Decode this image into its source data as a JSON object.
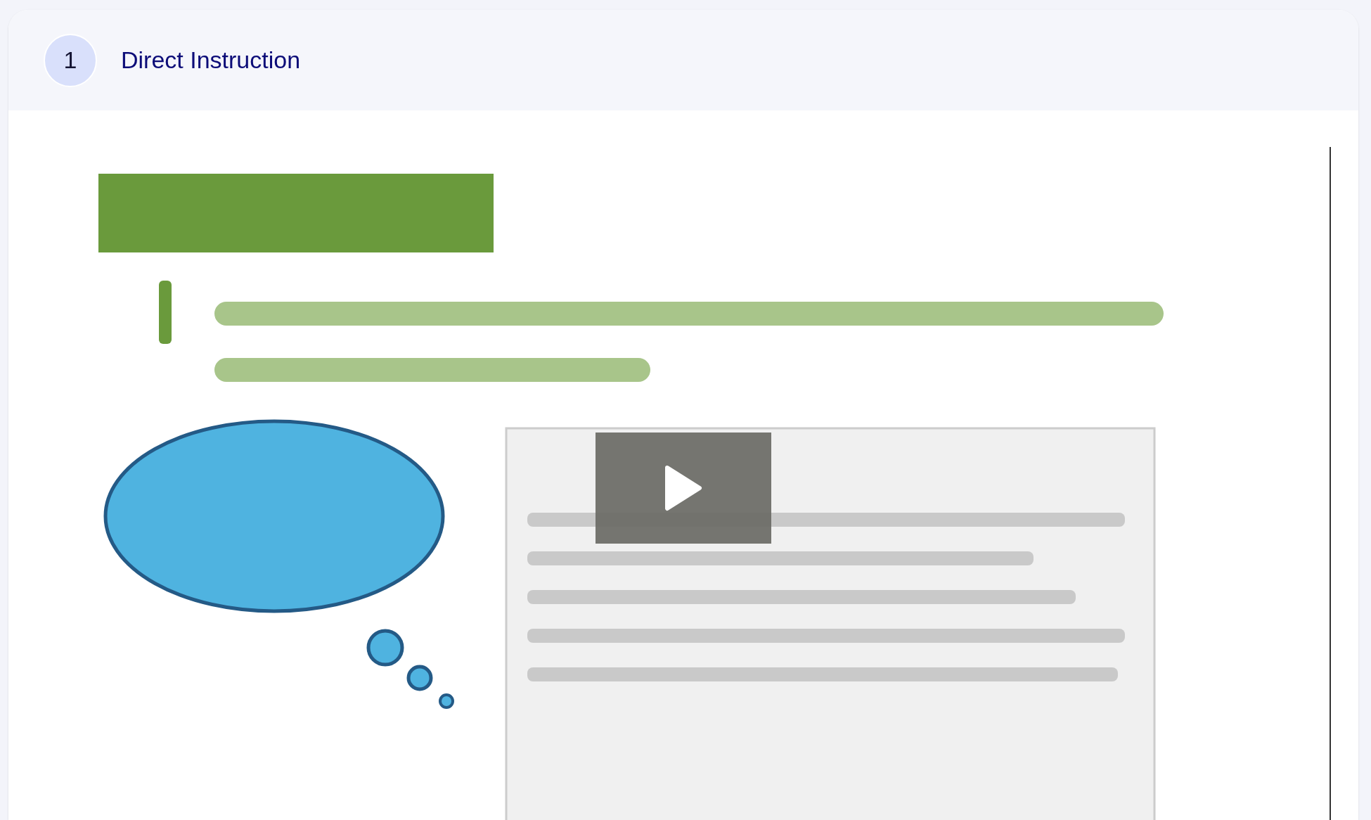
{
  "step": {
    "number": "1",
    "title": "Direct Instruction"
  }
}
